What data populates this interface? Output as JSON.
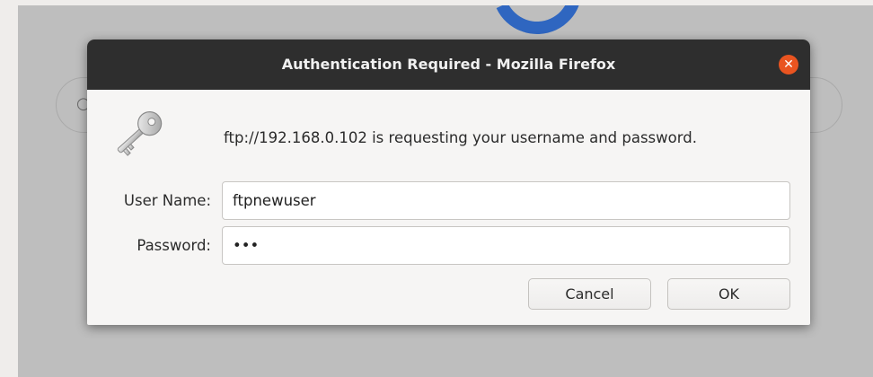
{
  "dialog": {
    "title": "Authentication Required - Mozilla Firefox",
    "close_glyph": "✕",
    "prompt": "ftp://192.168.0.102 is requesting your username and password.",
    "key_icon": "key-icon",
    "fields": {
      "username_label": "User Name:",
      "username_value": "ftpnewuser",
      "password_label": "Password:",
      "password_value": "abc"
    },
    "buttons": {
      "cancel_label": "Cancel",
      "ok_label": "OK"
    }
  },
  "colors": {
    "titlebar": "#2e2e2e",
    "close_button": "#e95420",
    "dialog_bg": "#f6f5f4",
    "backdrop": "#bebebe",
    "logo_blue": "#2f66c0"
  }
}
